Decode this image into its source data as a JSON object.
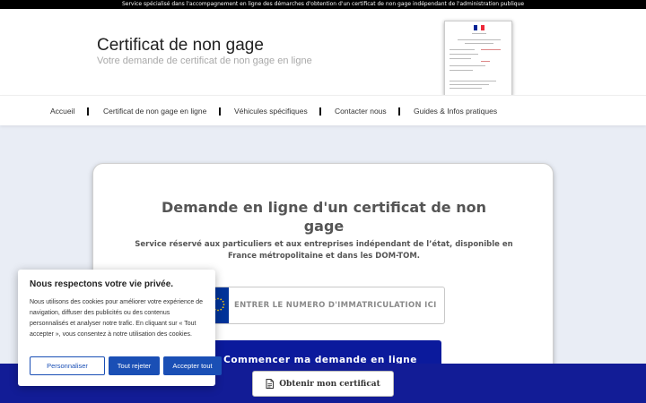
{
  "topbar": {
    "text": "Service spécialisé dans l'accompagnement en ligne des démarches d'obtention d'un certificat de non gage indépendant de l'administration publique"
  },
  "header": {
    "title": "Certificat de non gage",
    "tagline": "Votre demande de certificat de non gage en ligne",
    "flag_colors": [
      "#002395",
      "#ffffff",
      "#ed2939"
    ]
  },
  "nav": {
    "items": [
      {
        "label": "Accueil"
      },
      {
        "label": "Certificat de non gage en ligne"
      },
      {
        "label": "Véhicules spécifiques"
      },
      {
        "label": "Contacter nous"
      },
      {
        "label": "Guides & Infos pratiques"
      }
    ]
  },
  "form": {
    "title": "Demande en ligne d'un certificat de non gage",
    "subtitle": "Service réservé aux particuliers et aux entreprises indépendant de l’état, disponible en France métropolitaine et dans les DOM-TOM.",
    "plate_placeholder": "ENTRER LE NUMERO D'IMMATRICULATION ICI",
    "plate_value": "",
    "start_button": "Commencer ma demande en ligne",
    "accent_color": "#0b1a9c"
  },
  "bottom_bar": {
    "obtain_button": "Obtenir mon certificat",
    "icon": "document-icon"
  },
  "cookie": {
    "title": "Nous respectons votre vie privée.",
    "text": "Nous utilisons des cookies pour améliorer votre expérience de navigation, diffuser des publicités ou des contenus personnalisés et analyser notre trafic. En cliquant sur « Tout accepter », vous consentez à notre utilisation des cookies.",
    "customize": "Personnaliser",
    "reject": "Tout rejeter",
    "accept": "Accepter tout",
    "button_color": "#1a4fb5"
  }
}
